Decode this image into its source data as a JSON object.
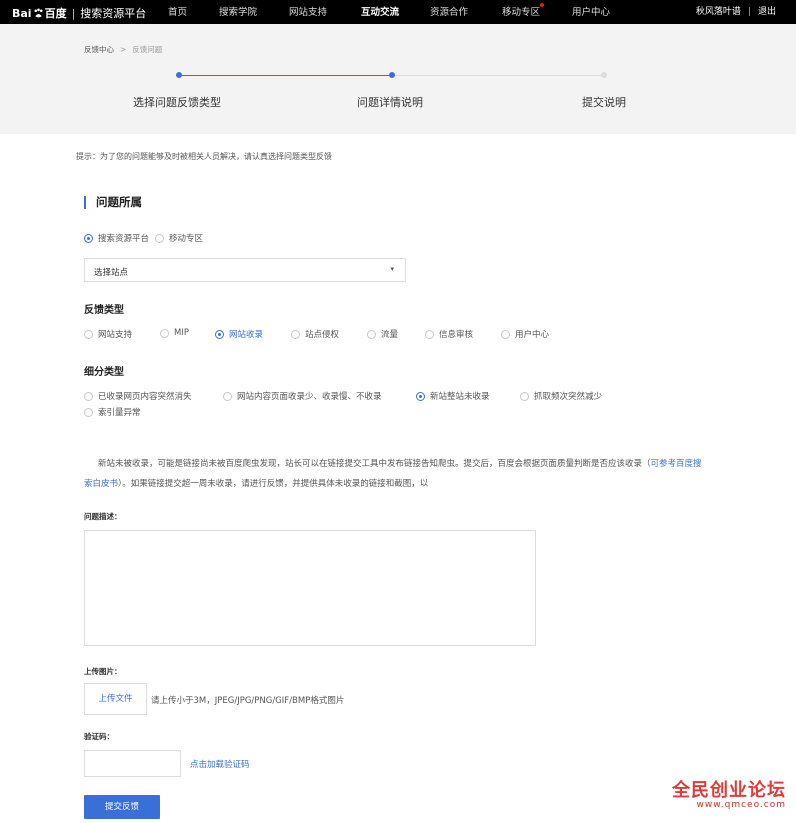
{
  "header": {
    "logo_text": "Bai",
    "logo_text2": "百度",
    "platform": "搜索资源平台",
    "nav": [
      "首页",
      "搜索学院",
      "网站支持",
      "互动交流",
      "资源合作",
      "移动专区",
      "用户中心"
    ],
    "active_nav": "互动交流",
    "username": "秋风落叶谱",
    "logout": "退出",
    "divider": "|"
  },
  "breadcrumb": {
    "root": "反馈中心",
    "sep": ">",
    "current": "反馈问题"
  },
  "steps": [
    {
      "label": "选择问题反馈类型",
      "state": "done"
    },
    {
      "label": "问题详情说明",
      "state": "current"
    },
    {
      "label": "提交说明",
      "state": "todo"
    }
  ],
  "hint": "提示：为了您的问题能够及时被相关人员解决，请认真选择问题类型反馈",
  "section": {
    "title": "问题所属",
    "belong_options": [
      {
        "label": "搜索资源平台",
        "checked": true
      },
      {
        "label": "移动专区",
        "checked": false
      }
    ],
    "site_select": "选择站点",
    "select_arrow": "▾",
    "feedback_type_title": "反馈类型",
    "feedback_types": [
      {
        "label": "网站支持",
        "checked": false
      },
      {
        "label": "MIP",
        "checked": false
      },
      {
        "label": "网站收录",
        "checked": true
      },
      {
        "label": "站点侵权",
        "checked": false
      },
      {
        "label": "流量",
        "checked": false
      },
      {
        "label": "信息审核",
        "checked": false
      },
      {
        "label": "用户中心",
        "checked": false
      }
    ],
    "sub_type_title": "细分类型",
    "sub_types": [
      {
        "label": "已收录网页内容突然消失",
        "checked": false
      },
      {
        "label": "网站内容页面收录少、收录慢、不收录",
        "checked": false
      },
      {
        "label": "新站整站未收录",
        "checked": true
      },
      {
        "label": "抓取频次突然减少",
        "checked": false
      },
      {
        "label": "索引量异常",
        "checked": false
      }
    ]
  },
  "description": {
    "text1": "新站未被收录，可能是链接尚未被百度爬虫发现，站长可以在链接提交工具中发布链接告知爬虫。提交后，百度会根据页面质量判断是否应该收录（",
    "link": "可参考百度搜索白皮书",
    "text2": "）。如果链接提交超一周未收录，请进行反馈，并提供具体未收录的链接和截图，以"
  },
  "form": {
    "problem_desc_label": "问题描述：",
    "upload_label": "上传图片：",
    "upload_button": "上传文件",
    "upload_hint": "请上传小于3M，JPEG/JPG/PNG/GIF/BMP格式图片",
    "captcha_label": "验证码：",
    "captcha_link": "点击加载验证码",
    "submit": "提交反馈"
  },
  "watermark": {
    "line1": "全民创业论坛",
    "line2": "www.qmceo.com"
  },
  "colors": {
    "accent": "#3a6fd8",
    "topbar": "#000000",
    "watermark": "#e03a3a"
  }
}
